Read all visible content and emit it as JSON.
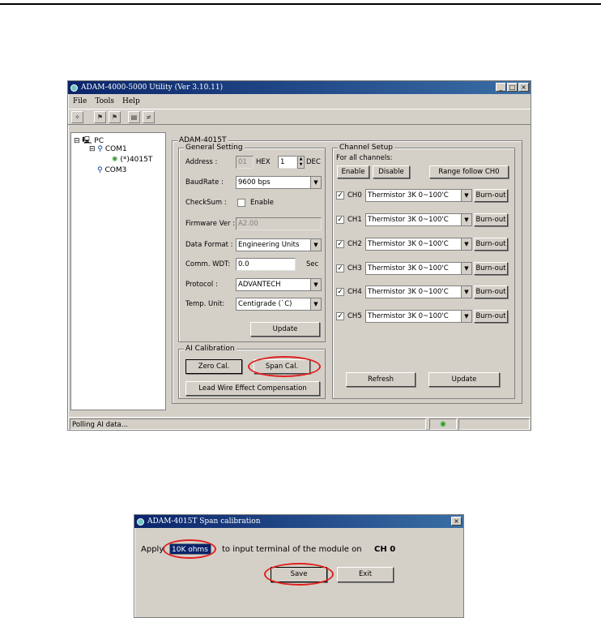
{
  "main_window": {
    "title": "ADAM-4000-5000 Utility (Ver 3.10.11)",
    "menu": [
      "File",
      "Tools",
      "Help"
    ],
    "tree": {
      "root": "PC",
      "com1": "COM1",
      "module": "(*)4015T",
      "com3": "COM3"
    },
    "module_title": "ADAM-4015T",
    "general": {
      "title": "General Setting",
      "address_label": "Address :",
      "address_dis": "01",
      "hex_label": "HEX",
      "address_dec": "1",
      "dec_label": "DEC",
      "baud_label": "BaudRate :",
      "baud_value": "9600 bps",
      "checksum_label": "CheckSum :",
      "enable_label": "Enable",
      "fw_label": "Firmware Ver :",
      "fw_value": "A2.00",
      "format_label": "Data Format :",
      "format_value": "Engineering Units",
      "wdt_label": "Comm. WDT:",
      "wdt_value": "0.0",
      "sec_label": "Sec",
      "protocol_label": "Protocol :",
      "protocol_value": "ADVANTECH",
      "temp_label": "Temp. Unit:",
      "temp_value": "Centigrade (`C)",
      "update_label": "Update"
    },
    "calibration": {
      "title": "AI Calibration",
      "zero_label": "Zero Cal.",
      "span_label": "Span Cal.",
      "lead_label": "Lead Wire Effect Compensation"
    },
    "channels": {
      "title": "Channel Setup",
      "all_label": "For all channels:",
      "enable_label": "Enable",
      "disable_label": "Disable",
      "range_label": "Range follow CH0",
      "list": [
        {
          "name": "CH0",
          "range": "Thermistor 3K 0~100'C",
          "burn": "Burn-out"
        },
        {
          "name": "CH1",
          "range": "Thermistor 3K 0~100'C",
          "burn": "Burn-out"
        },
        {
          "name": "CH2",
          "range": "Thermistor 3K 0~100'C",
          "burn": "Burn-out"
        },
        {
          "name": "CH3",
          "range": "Thermistor 3K 0~100'C",
          "burn": "Burn-out"
        },
        {
          "name": "CH4",
          "range": "Thermistor 3K 0~100'C",
          "burn": "Burn-out"
        },
        {
          "name": "CH5",
          "range": "Thermistor 3K 0~100'C",
          "burn": "Burn-out"
        }
      ],
      "refresh_label": "Refresh",
      "update_label": "Update"
    },
    "status_text": "Polling AI data..."
  },
  "dialog": {
    "title": "ADAM-4015T Span calibration",
    "apply_label": "Apply",
    "value": "10K ohms",
    "instruction": "to input terminal of the module on",
    "channel": "CH 0",
    "save_label": "Save",
    "exit_label": "Exit"
  },
  "colors": {
    "highlight_oval": "#e02020",
    "title_bar": "#0a246a"
  }
}
